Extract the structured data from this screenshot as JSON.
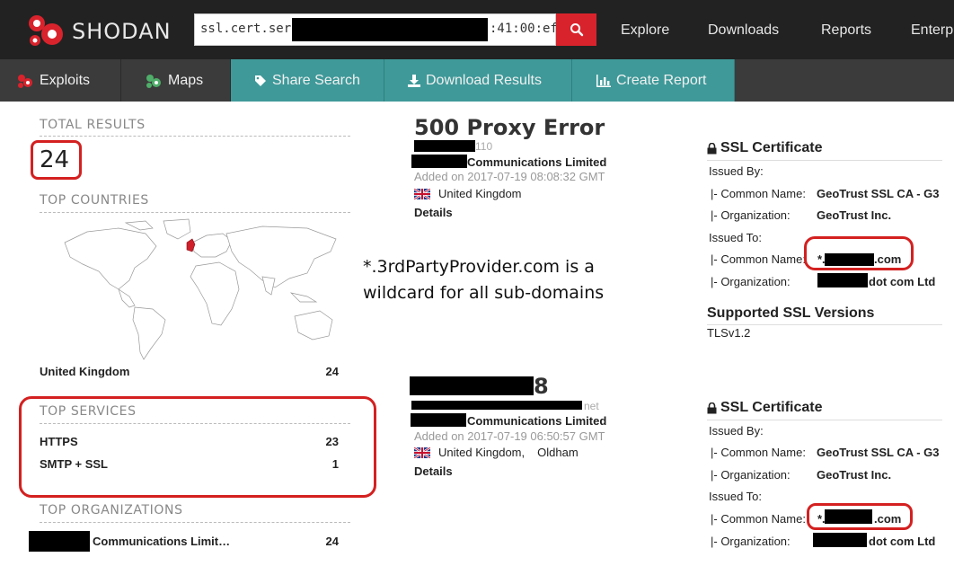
{
  "brand": {
    "name": "SHODAN"
  },
  "search": {
    "prefix": "ssl.cert.serial:",
    "suffix": ":41:00:ef:"
  },
  "topnav": [
    "Explore",
    "Downloads",
    "Reports",
    "Enterp"
  ],
  "subnav": {
    "exploits": "Exploits",
    "maps": "Maps",
    "share": "Share Search",
    "download": "Download Results",
    "report": "Create Report"
  },
  "sidebar": {
    "total_heading": "TOTAL RESULTS",
    "total": "24",
    "countries_heading": "TOP COUNTRIES",
    "countries": [
      {
        "name": "United Kingdom",
        "count": "24"
      }
    ],
    "services_heading": "TOP SERVICES",
    "services": [
      {
        "name": "HTTPS",
        "count": "23"
      },
      {
        "name": "SMTP + SSL",
        "count": "1"
      }
    ],
    "orgs_heading": "TOP ORGANIZATIONS",
    "orgs": [
      {
        "name": "Communications Limit…",
        "count": "24"
      }
    ]
  },
  "annotation": "*.3rdPartyProvider.com is a wildcard for all sub-domains",
  "results": [
    {
      "title": "500 Proxy Error",
      "ip_tail": "110",
      "org": "Communications Limited",
      "added": "Added on 2017-07-19 08:08:32 GMT",
      "country": "United Kingdom",
      "city": "",
      "details": "Details"
    },
    {
      "title": "8",
      "ip_tail": "net",
      "org": "Communications Limited",
      "added": "Added on 2017-07-19 06:50:57 GMT",
      "country": "United Kingdom",
      "city": "Oldham",
      "details": "Details"
    }
  ],
  "ssl": {
    "heading": "SSL Certificate",
    "issued_by": "Issued By:",
    "issued_to": "Issued To:",
    "cn_label": "|- Common Name:",
    "org_label": "|- Organization:",
    "issuer_cn": "GeoTrust SSL CA - G3",
    "issuer_org": "GeoTrust Inc.",
    "subject_cn_prefix": "*.",
    "subject_cn_suffix": ".com",
    "subject_org_suffix": "dot com Ltd",
    "versions_heading": "Supported SSL Versions",
    "versions": "TLSv1.2"
  },
  "colors": {
    "accent_red": "#d9232c",
    "teal": "#3f9999",
    "annotation_red": "#d42020"
  }
}
